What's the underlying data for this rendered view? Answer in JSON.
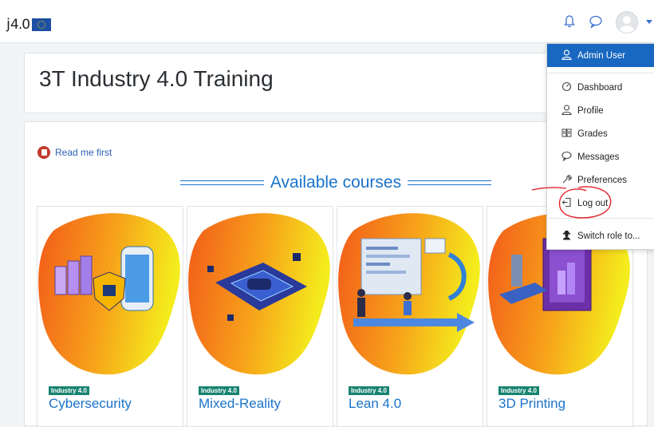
{
  "navbar": {
    "logo_text": "4.0",
    "icons": [
      "bell-icon",
      "chat-bubble-icon",
      "user-avatar",
      "chevron-down-icon"
    ]
  },
  "page": {
    "title": "3T Industry 4.0 Training"
  },
  "main": {
    "readme_label": "Read me first",
    "section_heading": "Available courses",
    "courses": [
      {
        "badge": "Industry 4.0",
        "name": "Cybersecurity"
      },
      {
        "badge": "Industry 4.0",
        "name": "Mixed-Reality"
      },
      {
        "badge": "Industry 4.0",
        "name": "Lean 4.0"
      },
      {
        "badge": "Industry 4.0",
        "name": "3D Printing"
      }
    ]
  },
  "user_menu": {
    "header": {
      "label": "Admin User",
      "icon": "user-icon"
    },
    "items": [
      {
        "label": "Dashboard",
        "icon": "dashboard-icon"
      },
      {
        "label": "Profile",
        "icon": "user-icon"
      },
      {
        "label": "Grades",
        "icon": "grades-icon"
      },
      {
        "label": "Messages",
        "icon": "chat-bubble-icon"
      },
      {
        "label": "Preferences",
        "icon": "wrench-icon"
      },
      {
        "label": "Log out",
        "icon": "logout-icon"
      },
      {
        "label": "Switch role to...",
        "icon": "user-secret-icon"
      }
    ]
  },
  "colors": {
    "primary": "#1867c0",
    "link": "#1a73c9",
    "badge": "#17836f",
    "annotation": "#e0242a"
  }
}
